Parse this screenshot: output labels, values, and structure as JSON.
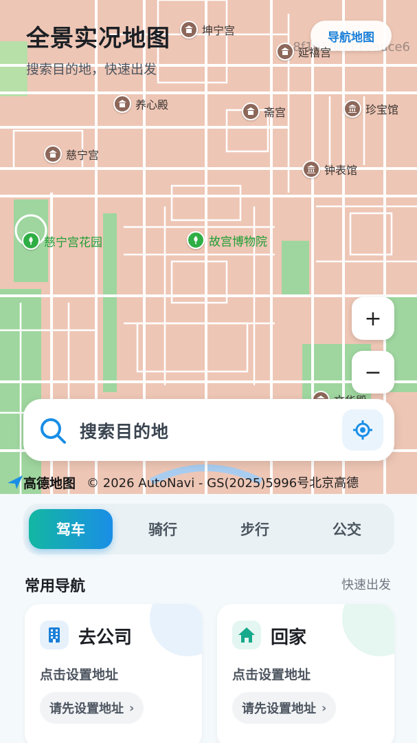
{
  "header": {
    "title": "全景实况地图",
    "subtitle": "搜索目的地，快速出发",
    "nav_map_button": "导航地图",
    "map_id": "8f195fb7116adce6"
  },
  "map": {
    "pois": [
      {
        "label": "坤宁宫",
        "icon": "palace-icon",
        "kind": "palace"
      },
      {
        "label": "延禧宫",
        "icon": "palace-icon",
        "kind": "palace"
      },
      {
        "label": "养心殿",
        "icon": "palace-icon",
        "kind": "palace"
      },
      {
        "label": "斋宫",
        "icon": "palace-icon",
        "kind": "palace"
      },
      {
        "label": "珍宝馆",
        "icon": "museum-icon",
        "kind": "museum"
      },
      {
        "label": "慈宁宫",
        "icon": "palace-icon",
        "kind": "palace"
      },
      {
        "label": "钟表馆",
        "icon": "museum-icon",
        "kind": "museum"
      },
      {
        "label": "慈宁宫花园",
        "icon": "park-icon",
        "kind": "park"
      },
      {
        "label": "故宫博物院",
        "icon": "park-icon",
        "kind": "park"
      },
      {
        "label": "文华殿",
        "icon": "palace-icon",
        "kind": "palace"
      }
    ],
    "zoom_in": "+",
    "zoom_out": "−",
    "colors": {
      "land": "#eec6b5",
      "road": "#ffffff",
      "park": "#9fd69f",
      "water": "#a9cdf0",
      "accent": "#1a8ee6"
    }
  },
  "search": {
    "placeholder": "搜索目的地",
    "search_icon": "search-icon",
    "locate_icon": "locate-icon"
  },
  "attribution": {
    "logo_text": "高德地图",
    "copyright": "© 2026 AutoNavi - GS(2025)5996号北京高德"
  },
  "modes": {
    "tabs": [
      "驾车",
      "骑行",
      "步行",
      "公交"
    ],
    "active": "驾车"
  },
  "common_nav": {
    "title": "常用导航",
    "quick_link": "快速出发",
    "cards": [
      {
        "name": "去公司",
        "icon": "building-icon",
        "hint": "点击设置地址",
        "button": "请先设置地址",
        "color": "#1a7fd8"
      },
      {
        "name": "回家",
        "icon": "home-icon",
        "hint": "点击设置地址",
        "button": "请先设置地址",
        "color": "#17a98c"
      }
    ]
  }
}
